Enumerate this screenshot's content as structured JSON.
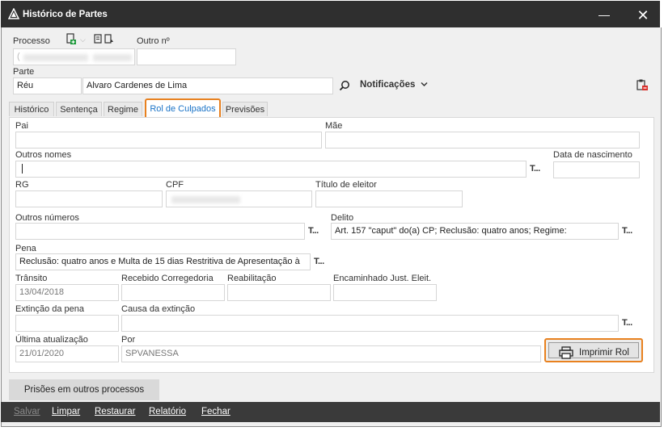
{
  "window": {
    "title": "Histórico de Partes",
    "minimize_symbol": "—",
    "close_symbol": "✕"
  },
  "header": {
    "processo_label": "Processo",
    "outro_label": "Outro nº",
    "processo_prefix": "(",
    "parte_label": "Parte",
    "parte_tipo": "Réu",
    "parte_nome": "Alvaro Cardenes de Lima",
    "notificacoes_label": "Notificações"
  },
  "tabs": [
    {
      "label": "Histórico",
      "ul": "H"
    },
    {
      "label": "Sentença",
      "ul": "e"
    },
    {
      "label": "Regime",
      "ul": "i"
    },
    {
      "label": "Rol de Culpados",
      "ul": "u"
    },
    {
      "label": "Previsões",
      "ul": "P"
    }
  ],
  "active_tab": "Rol de Culpados",
  "form": {
    "pai_label": "Pai",
    "mae_label": "Mãe",
    "outros_nomes_label": "Outros nomes",
    "data_nascimento_label": "Data de nascimento",
    "rg_label": "RG",
    "cpf_label": "CPF",
    "titulo_label": "Título de eleitor",
    "outros_numeros_label": "Outros números",
    "delito_label": "Delito",
    "delito_value": "Art. 157 \"caput\" do(a) CP; Reclusão: quatro anos; Regime:",
    "pena_label": "Pena",
    "pena_value": "Reclusão: quatro anos e Multa de 15 dias Restritiva de Apresentação à",
    "transito_label": "Trânsito",
    "transito_value": "13/04/2018",
    "recebido_label": "Recebido Corregedoria",
    "reabilitacao_label": "Reabilitação",
    "encaminhado_label": "Encaminhado Just. Eleit.",
    "extincao_label": "Extinção da pena",
    "causa_label": "Causa da extinção",
    "ultima_label": "Última atualização",
    "ultima_value": "21/01/2020",
    "por_label": "Por",
    "por_value": "SPVANESSA",
    "text_btn": "T..."
  },
  "print_button": "Imprimir Rol",
  "prisoes_button": "Prisões em outros processos",
  "toolbar": [
    {
      "label": "Salvar",
      "disabled": true
    },
    {
      "label": "Limpar",
      "disabled": false
    },
    {
      "label": "Restaurar",
      "disabled": false
    },
    {
      "label": "Relatório",
      "disabled": false
    },
    {
      "label": "Fechar",
      "disabled": false
    }
  ],
  "colors": {
    "titlebar": "#2f2f2f",
    "highlight": "#e8811f",
    "active_tab_text": "#1a73c7"
  },
  "icons": [
    "app-icon",
    "document-add-icon",
    "chevron-down-icon",
    "document-export-icon",
    "search-icon",
    "clipboard-delete-icon",
    "printer-icon"
  ]
}
